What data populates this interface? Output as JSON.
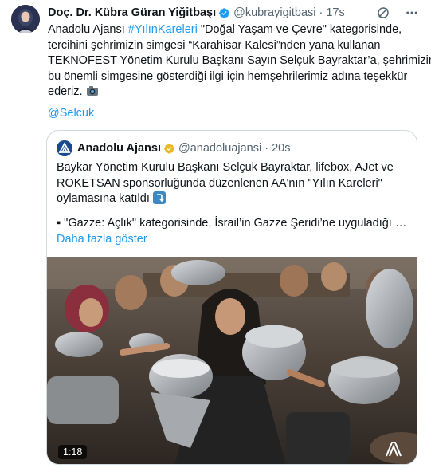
{
  "author": {
    "name": "Doç. Dr. Kübra Güran Yiğitbaşı",
    "handle": "@kubrayigitbasi",
    "dot": "·",
    "time": "17s"
  },
  "tweet": {
    "line1_pre": "Anadolu Ajansı ",
    "line1_hashtag": "#YılınKareleri",
    "line1_post": " \"Doğal Yaşam ve Çevre\" kategorisinde,",
    "line2": "tercihini şehrimizin simgesi “Karahisar Kalesi”nden yana kullanan",
    "line3": "TEKNOFEST Yönetim Kurulu Başkanı Sayın Selçuk Bayraktar’a, şehrimizin",
    "line4": "bu önemli simgesine gösterdiği ilgi için hemşehrilerimiz adına teşekkür",
    "line5": "ederiz.",
    "mention": "@Selcuk"
  },
  "quote": {
    "name": "Anadolu Ajansı",
    "handle": "@anadoluajansi",
    "dot": "·",
    "time": "20s",
    "line1": "Baykar Yönetim Kurulu Başkanı Selçuk Bayraktar, lifebox, AJet ve",
    "line2": "ROKETSAN sponsorluğunda düzenlenen AA'nın \"Yılın Kareleri\"",
    "line3": "oylamasına katıldı",
    "bullet": "▪  \"Gazze: Açlık\" kategorisinde, İsrail’in Gazze Şeridi’ne uyguladığı …",
    "more": "Daha fazla göster",
    "duration": "1:18"
  },
  "colors": {
    "link": "#1d9bf0",
    "verified_blue": "#1d9bf0",
    "verified_gold": "#e8b829",
    "muted": "#536471"
  }
}
